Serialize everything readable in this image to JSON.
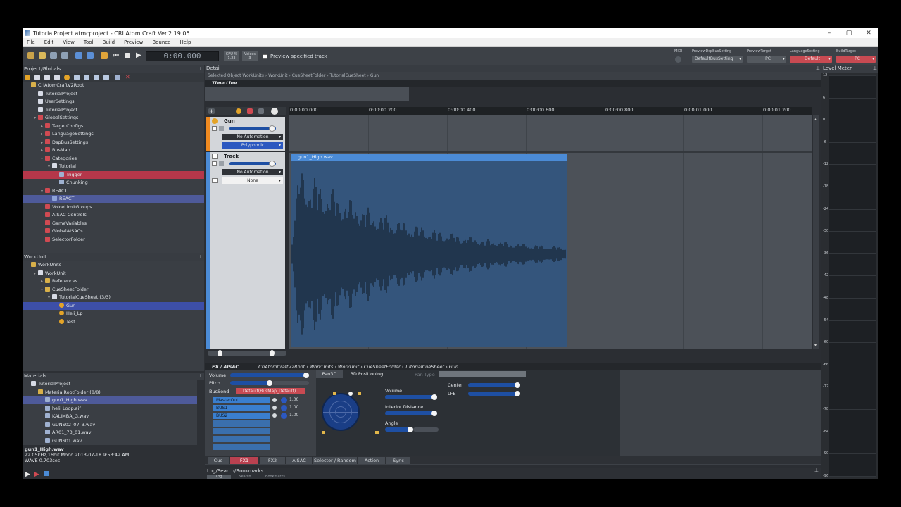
{
  "window": {
    "title": "TutorialProject.atmcproject - CRI Atom Craft Ver.2.19.05",
    "min": "–",
    "max": "▢",
    "close": "✕"
  },
  "menu": [
    "File",
    "Edit",
    "View",
    "Tool",
    "Build",
    "Preview",
    "Bounce",
    "Help"
  ],
  "toolbar": {
    "time": "0:00.000",
    "cpu_label": "CPU %",
    "cpu_value": "1.23",
    "voices_label": "Voices",
    "voices_value": "3",
    "preview_specified_track": "Preview specified track",
    "midi_label": "MIDI",
    "preview_dsp_label": "PreviewDspBusSetting",
    "preview_dsp_value": "DefaultBusSetting",
    "preview_target_label": "PreviewTarget",
    "preview_target_value": "PC",
    "language_label": "LanguageSetting",
    "language_value": "Default",
    "build_target_label": "BuildTarget",
    "build_target_value": "PC"
  },
  "project_panel": {
    "title": "Project/Globals",
    "items": [
      {
        "label": "CriAtomCraftV2Root",
        "indent": 0,
        "icon": "folder-yel"
      },
      {
        "label": "TutorialProject",
        "indent": 1,
        "icon": "doc"
      },
      {
        "label": "UserSettings",
        "indent": 1,
        "icon": "doc"
      },
      {
        "label": "TutorialProject",
        "indent": 1,
        "icon": "doc"
      },
      {
        "label": "GlobalSettings",
        "indent": 1,
        "icon": "folder-red",
        "arrow": "▾"
      },
      {
        "label": "TargetConfigs",
        "indent": 2,
        "icon": "folder-red",
        "arrow": "▸"
      },
      {
        "label": "LanguageSettings",
        "indent": 2,
        "icon": "folder-red",
        "arrow": "▸"
      },
      {
        "label": "DspBusSettings",
        "indent": 2,
        "icon": "folder-red",
        "arrow": "▸"
      },
      {
        "label": "BusMap",
        "indent": 2,
        "icon": "folder-red",
        "arrow": "▸"
      },
      {
        "label": "Categories",
        "indent": 2,
        "icon": "folder-red",
        "arrow": "▾"
      },
      {
        "label": "Tutorial",
        "indent": 3,
        "icon": "doc",
        "arrow": "▾"
      },
      {
        "label": "Trigger",
        "indent": 4,
        "icon": "wav",
        "sel": "red"
      },
      {
        "label": "Chunking",
        "indent": 4,
        "icon": "wav"
      },
      {
        "label": "REACT",
        "indent": 2,
        "icon": "folder-red",
        "arrow": "▾"
      },
      {
        "label": "REACT",
        "indent": 3,
        "icon": "react",
        "sel": "blue-light"
      },
      {
        "label": "VoiceLimitGroups",
        "indent": 2,
        "icon": "folder-red"
      },
      {
        "label": "AISAC-Controls",
        "indent": 2,
        "icon": "folder-red"
      },
      {
        "label": "GameVariables",
        "indent": 2,
        "icon": "folder-red"
      },
      {
        "label": "GlobalAISACs",
        "indent": 2,
        "icon": "folder-red"
      },
      {
        "label": "SelectorFolder",
        "indent": 2,
        "icon": "folder-red"
      }
    ]
  },
  "workunit_panel": {
    "title": "WorkUnit",
    "items": [
      {
        "label": "WorkUnits",
        "indent": 0,
        "icon": "folder-yel"
      },
      {
        "label": "WorkUnit",
        "indent": 1,
        "icon": "doc",
        "arrow": "▾"
      },
      {
        "label": "References",
        "indent": 2,
        "icon": "folder-yel",
        "arrow": "▸"
      },
      {
        "label": "CueSheetFolder",
        "indent": 2,
        "icon": "folder-yel",
        "arrow": "▾"
      },
      {
        "label": "TutorialCueSheet  (3/3)",
        "indent": 3,
        "icon": "doc",
        "arrow": "▾"
      },
      {
        "label": "Gun",
        "indent": 4,
        "icon": "cue",
        "sel": "blue"
      },
      {
        "label": "Heli_Lp",
        "indent": 4,
        "icon": "cue"
      },
      {
        "label": "Test",
        "indent": 4,
        "icon": "cue"
      }
    ]
  },
  "materials_panel": {
    "title": "Materials",
    "items": [
      {
        "label": "TutorialProject",
        "indent": 0,
        "icon": "doc"
      },
      {
        "label": "MaterialRootFolder  (8/8)",
        "indent": 1,
        "icon": "folder-yel"
      },
      {
        "label": "gun1_High.wav",
        "indent": 2,
        "icon": "wav",
        "sel": "blue-light"
      },
      {
        "label": "heli_Loop.aif",
        "indent": 2,
        "icon": "wav"
      },
      {
        "label": "KALIMBA_G.wav",
        "indent": 2,
        "icon": "wav"
      },
      {
        "label": "GUNS02_07_3.wav",
        "indent": 2,
        "icon": "wav"
      },
      {
        "label": "AR01_73_01.wav",
        "indent": 2,
        "icon": "wav"
      },
      {
        "label": "GUNS01.wav",
        "indent": 2,
        "icon": "wav"
      }
    ],
    "info": {
      "name": "gun1_High.wav",
      "format": "22.05kHz,16bit Mono  2013-07-18 9:53:42 AM",
      "length": "WAVE 0.703sec"
    }
  },
  "detail": {
    "title": "Detail",
    "breadcrumb": "Selected Object   WorkUnits  ›  WorkUnit  ›  CueSheetFolder  ›  TutorialCueSheet  ›  Gun",
    "timeline_title": "Time Line",
    "ruler": [
      "0:00:00.000",
      "0:00:00.200",
      "0:00:00.400",
      "0:00:00.600",
      "0:00:00.800",
      "0:00:01.000",
      "0:00:01.200"
    ],
    "cue_track": {
      "name": "Gun",
      "automation": "No Automation",
      "mode": "Polyphonic"
    },
    "track": {
      "name": "Track",
      "automation": "No Automation",
      "mode": "None"
    },
    "clip_name": "gun1_High.wav"
  },
  "fx": {
    "title": "FX / AISAC",
    "path": "CriAtomCraftV2Root  ›  WorkUnits  ›  WorkUnit  ›  CueSheetFolder  ›  TutorialCueSheet  ›  Gun",
    "volume_label": "Volume",
    "pitch_label": "Pitch",
    "bussend_label": "BusSend",
    "busmap_value": "Default(BusMap_Default)",
    "buses": [
      {
        "name": "MasterOut",
        "value": "1.00"
      },
      {
        "name": "BUS1",
        "value": "1.00"
      },
      {
        "name": "BUS2",
        "value": "1.00"
      }
    ],
    "pan_tabs": [
      "Pan3D",
      "3D Positioning"
    ],
    "pan_type_label": "Pan Type",
    "pan_controls": [
      "Volume",
      "Interior Distance",
      "Angle"
    ],
    "center_label": "Center",
    "lfe_label": "LFE",
    "tabs": [
      "Cue",
      "FX1",
      "FX2",
      "AISAC",
      "Selector / Random",
      "Action",
      "Sync"
    ]
  },
  "log": {
    "title": "Log/Search/Bookmarks",
    "tabs": [
      "Log",
      "Search",
      "Bookmarks"
    ]
  },
  "meter": {
    "title": "Level Meter",
    "ticks": [
      "12",
      "6",
      "0",
      "-6",
      "-12",
      "-18",
      "-24",
      "-30",
      "-36",
      "-42",
      "-48",
      "-54",
      "-60",
      "-66",
      "-72",
      "-78",
      "-84",
      "-90",
      "-96"
    ]
  }
}
